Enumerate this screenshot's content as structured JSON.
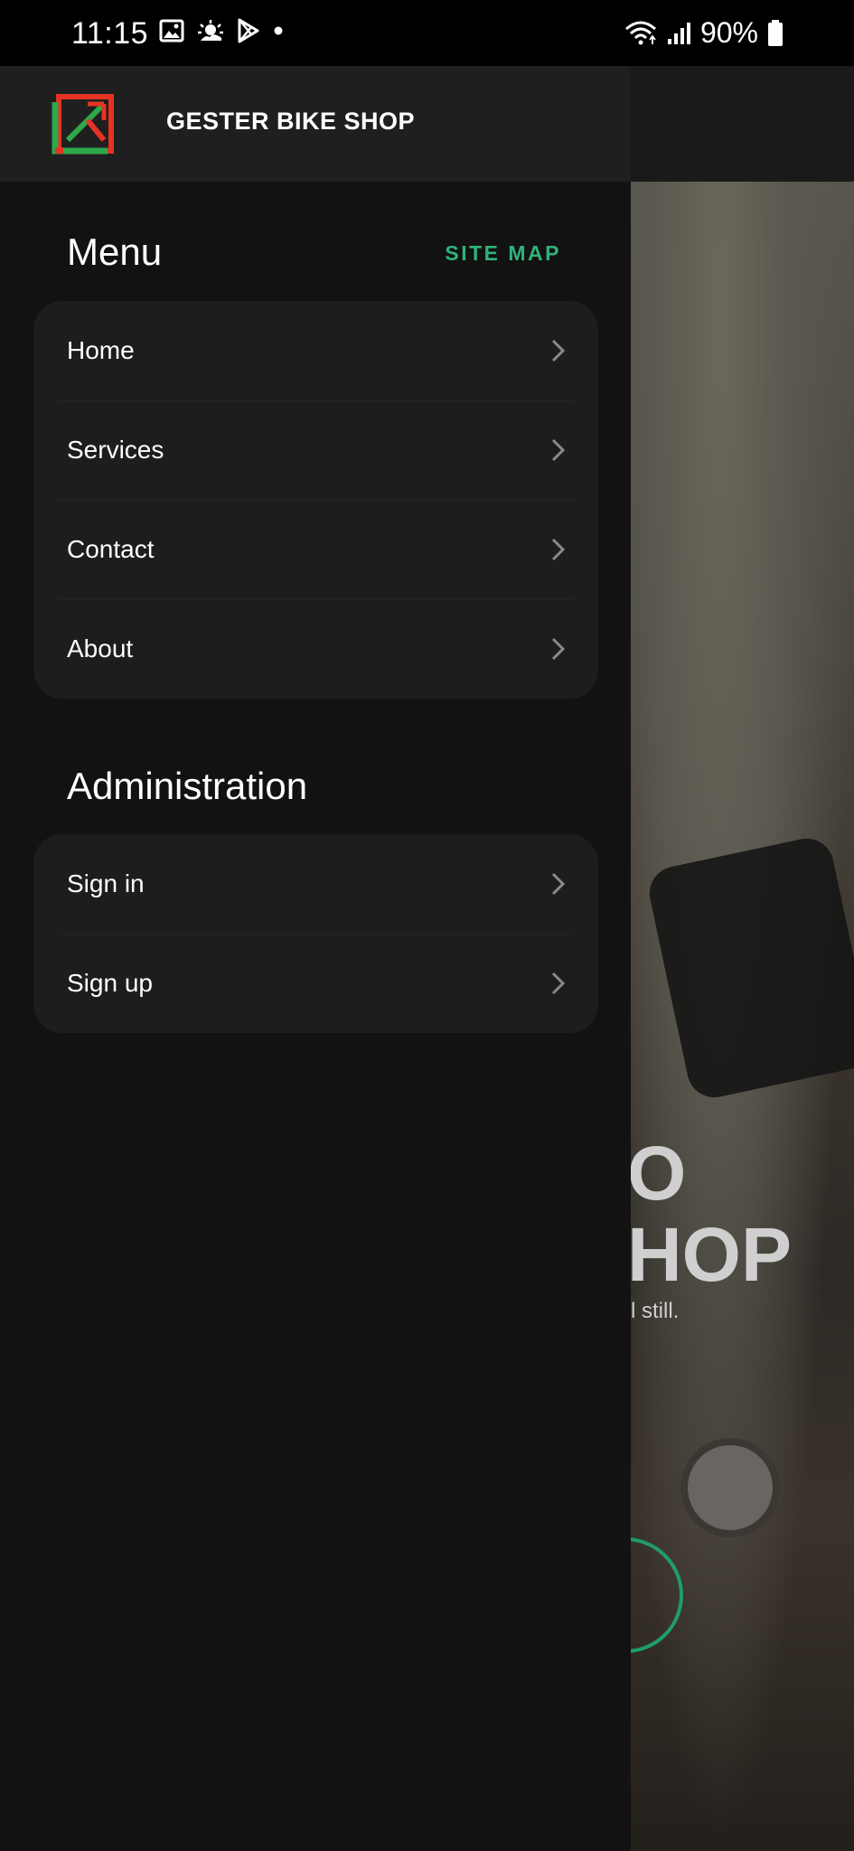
{
  "status_bar": {
    "time": "11:15",
    "battery": "90%",
    "icons": [
      "gallery-icon",
      "weather-icon",
      "play-store-icon",
      "notification-dot-icon",
      "wifi-icon",
      "signal-icon",
      "battery-icon"
    ]
  },
  "drawer": {
    "brand": "GESTER BIKE SHOP",
    "menu": {
      "title": "Menu",
      "site_map_label": "SITE MAP",
      "items": [
        {
          "label": "Home"
        },
        {
          "label": "Services"
        },
        {
          "label": "Contact"
        },
        {
          "label": "About"
        }
      ]
    },
    "administration": {
      "title": "Administration",
      "items": [
        {
          "label": "Sign in"
        },
        {
          "label": "Sign up"
        }
      ]
    }
  },
  "background_page": {
    "hero_line1": "O",
    "hero_line2": "HOP",
    "hero_sub": "l still."
  },
  "colors": {
    "accent": "#2fb37a",
    "drawer_bg": "#121212",
    "card_bg": "#1d1d1d",
    "header_bg": "#1f1f1f"
  }
}
